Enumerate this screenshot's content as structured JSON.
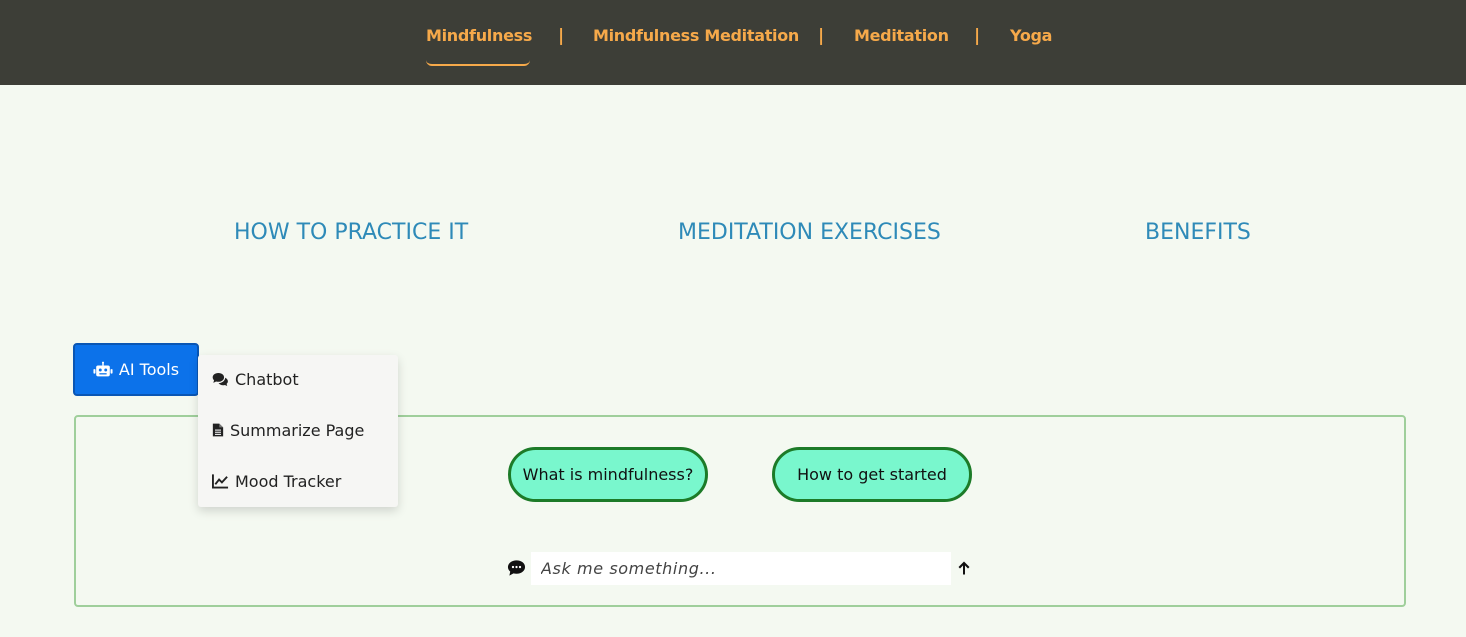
{
  "nav": {
    "items": [
      {
        "label": "Mindfulness",
        "active": true
      },
      {
        "label": "Mindfulness Meditation"
      },
      {
        "label": "Meditation"
      },
      {
        "label": "Yoga"
      }
    ],
    "separator": "|"
  },
  "sections": [
    {
      "label": "HOW TO PRACTICE IT"
    },
    {
      "label": "MEDITATION EXERCISES"
    },
    {
      "label": "BENEFITS"
    }
  ],
  "ai_tools": {
    "label": "AI Tools",
    "icon": "robot-icon",
    "menu": [
      {
        "label": "Chatbot",
        "icon": "comments-icon"
      },
      {
        "label": "Summarize Page",
        "icon": "document-icon"
      },
      {
        "label": "Mood Tracker",
        "icon": "line-chart-icon"
      }
    ]
  },
  "chat": {
    "suggestions": [
      "What is mindfulness?",
      "How to get started"
    ],
    "placeholder": "Ask me something...",
    "input_icon": "speech-bubble-icon",
    "send_icon": "arrow-up-icon"
  },
  "colors": {
    "nav_bg": "#3d3e37",
    "nav_text": "#f6a94a",
    "section_text": "#2e8ab8",
    "button_primary": "#0c72ea",
    "pill_bg": "#79f7cd",
    "pill_border": "#1c7b28",
    "page_bg": "#f4f9f1"
  }
}
